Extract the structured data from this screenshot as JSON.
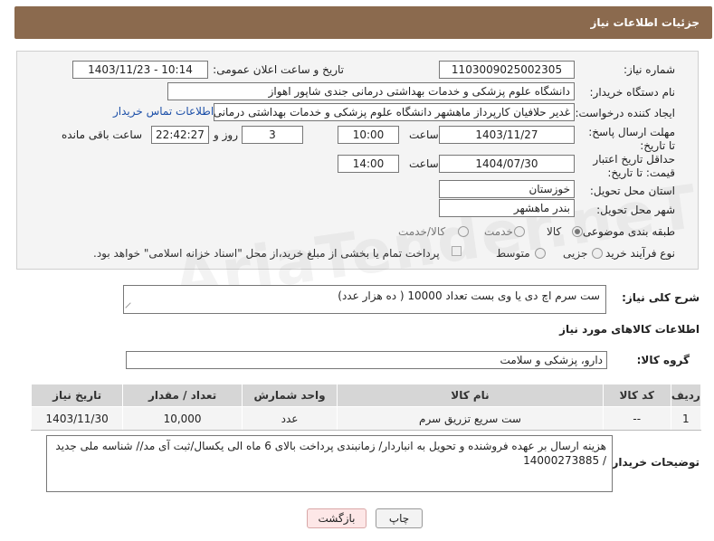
{
  "header": {
    "title": "جزئیات اطلاعات نیاز"
  },
  "form": {
    "need_number": {
      "label": "شماره نیاز:",
      "value": "1103009025002305"
    },
    "announce": {
      "label": "تاریخ و ساعت اعلان عمومی:",
      "value": "1403/11/23 - 10:14"
    },
    "buyer_org": {
      "label": "نام دستگاه خریدار:",
      "value": "دانشگاه علوم پزشکی و خدمات بهداشتی درمانی جندی شاپور اهواز"
    },
    "requester": {
      "label": "ایجاد کننده درخواست:",
      "value": "غدیر حلافیان کارپرداز ماهشهر دانشگاه علوم پزشکی و خدمات بهداشتی درمانی",
      "contact_link": "اطلاعات تماس خریدار"
    },
    "reply_deadline": {
      "label": "مهلت ارسال پاسخ: تا تاریخ:",
      "date": "1403/11/27",
      "time_label": "ساعت",
      "time": "10:00",
      "days": "3",
      "days_label": "روز و",
      "remaining": "22:42:27",
      "remaining_label": "ساعت باقی مانده"
    },
    "price_validity": {
      "label": "حداقل تاریخ اعتبار قیمت: تا تاریخ:",
      "date": "1404/07/30",
      "time_label": "ساعت",
      "time": "14:00"
    },
    "province": {
      "label": "استان محل تحویل:",
      "value": "خوزستان"
    },
    "city": {
      "label": "شهر محل تحویل:",
      "value": "بندر ماهشهر"
    },
    "category": {
      "label": "طبقه بندی موضوعی:",
      "options": [
        "کالا",
        "خدمت",
        "کالا/خدمت"
      ],
      "selected": "کالا"
    },
    "process": {
      "label": "نوع فرآیند خرید :",
      "options": [
        "جزیی",
        "متوسط"
      ],
      "selected": "جزیی",
      "note": "پرداخت تمام یا بخشی از مبلغ خرید،از محل \"اسناد خزانه اسلامی\" خواهد بود."
    }
  },
  "summary": {
    "label": "شرح کلی نیاز:",
    "value": "ست سرم اچ دی یا وی بست تعداد 10000 ( ده هزار عدد)"
  },
  "goods_info": {
    "title": "اطلاعات کالاهای مورد نیاز",
    "group_label": "گروه کالا:",
    "group_value": "دارو، پزشکی و سلامت"
  },
  "table": {
    "headers": [
      "ردیف",
      "کد کالا",
      "نام کالا",
      "واحد شمارش",
      "تعداد / مقدار",
      "تاریخ نیاز"
    ],
    "rows": [
      [
        "1",
        "--",
        "ست سریع تزریق سرم",
        "عدد",
        "10,000",
        "1403/11/30"
      ]
    ]
  },
  "buyer_notes": {
    "label": "توضیحات خریدار:",
    "value": "هزینه ارسال بر عهده فروشنده و تحویل به انباردار/ زمانبندی پرداخت بالای 6 ماه الی یکسال/ثبت آی مد// شناسه ملی جدید / 14000273885"
  },
  "buttons": {
    "print": "چاپ",
    "back": "بازگشت"
  },
  "watermark": "AriaTender.neT"
}
